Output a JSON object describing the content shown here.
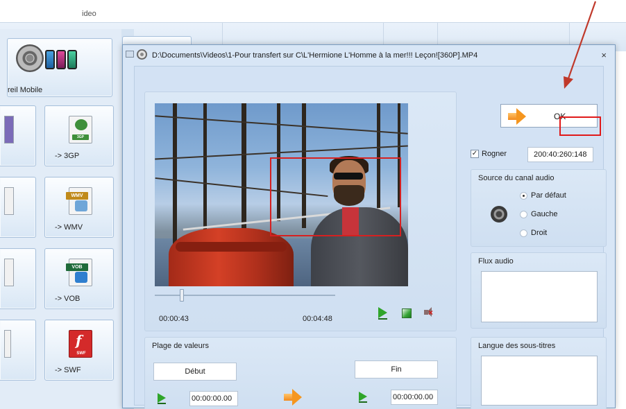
{
  "background": {
    "top_text": "ideo",
    "mobile_label": "reil Mobile",
    "formats": [
      {
        "label": "-> 3GP",
        "tag": "3GP",
        "color": "#3f8f3a"
      },
      {
        "label": "-> WMV",
        "tag": "WMV",
        "color": "#c08a1b"
      },
      {
        "label": "-> VOB",
        "tag": "VOB",
        "color": "#2f7fcf"
      },
      {
        "label": "-> SWF",
        "tag": "SWF",
        "color": "#d42a2a"
      }
    ]
  },
  "dialog": {
    "title": "D:\\Documents\\Videos\\1-Pour transfert sur C\\L'Hermione  L'Homme à la mer!!! Leçon![360P].MP4",
    "close": "×",
    "player": {
      "current_time": "00:00:43",
      "total_time": "00:04:48",
      "seek_fraction": 0.15
    },
    "range": {
      "title": "Plage de valeurs",
      "start_label": "Début",
      "end_label": "Fin",
      "start_value": "00:00:00.00",
      "end_value": "00:00:00.00"
    },
    "ok_label": "OK",
    "crop": {
      "label": "Rogner",
      "checked": true,
      "value": "200:40:260:148"
    },
    "audio_source": {
      "title": "Source du canal audio",
      "options": [
        "Par défaut",
        "Gauche",
        "Droit"
      ],
      "selected": "Par défaut"
    },
    "audio_stream": {
      "title": "Flux audio"
    },
    "subtitles": {
      "title": "Langue des sous-titres"
    }
  },
  "colors": {
    "annotation": "#d62020",
    "dialog_bg": "#d8e6f6",
    "accent_green": "#2fa52a",
    "accent_orange": "#f5961f"
  }
}
